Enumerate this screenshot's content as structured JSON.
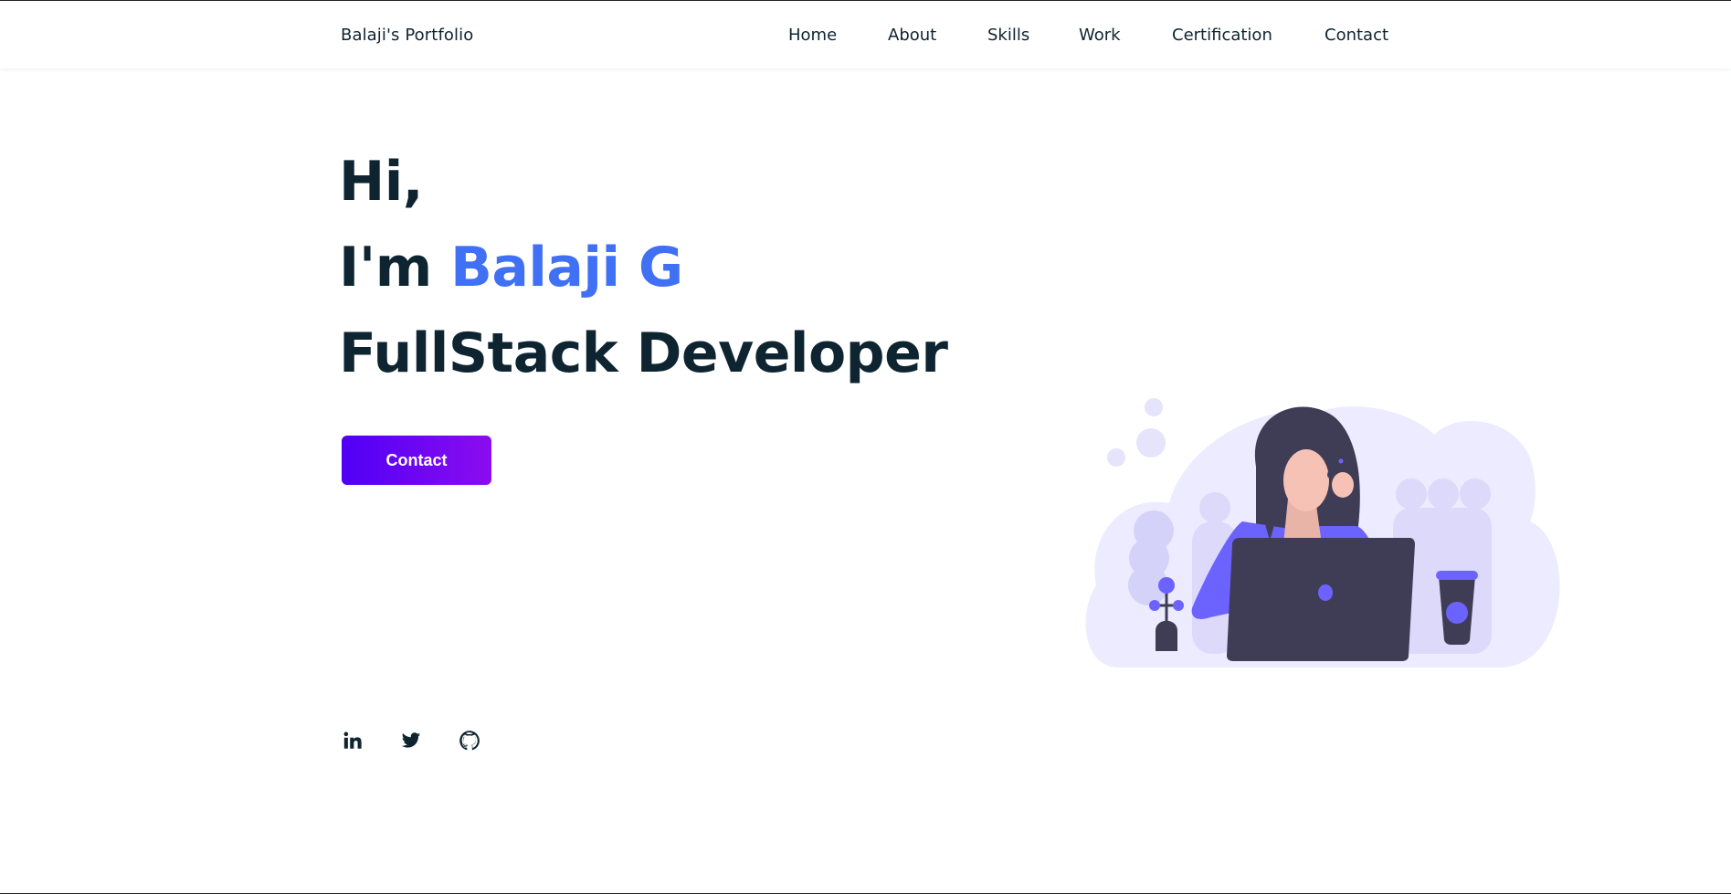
{
  "header": {
    "logo": "Balaji's Portfolio",
    "nav": [
      "Home",
      "About",
      "Skills",
      "Work",
      "Certification",
      "Contact"
    ]
  },
  "hero": {
    "line1": "Hi,",
    "line2_prefix": "I'm ",
    "line2_name": "Balaji G",
    "line3": "FullStack Developer",
    "button_label": "Contact"
  },
  "social": {
    "icons": [
      "linkedin-icon",
      "twitter-icon",
      "github-icon"
    ]
  },
  "colors": {
    "text": "#0e2431",
    "accent": "#4070f4",
    "button_gradient_start": "#4f00f5",
    "button_gradient_end": "#8b0cf0",
    "illustration_purple": "#6c63ff",
    "illustration_dark": "#3f3d56"
  }
}
